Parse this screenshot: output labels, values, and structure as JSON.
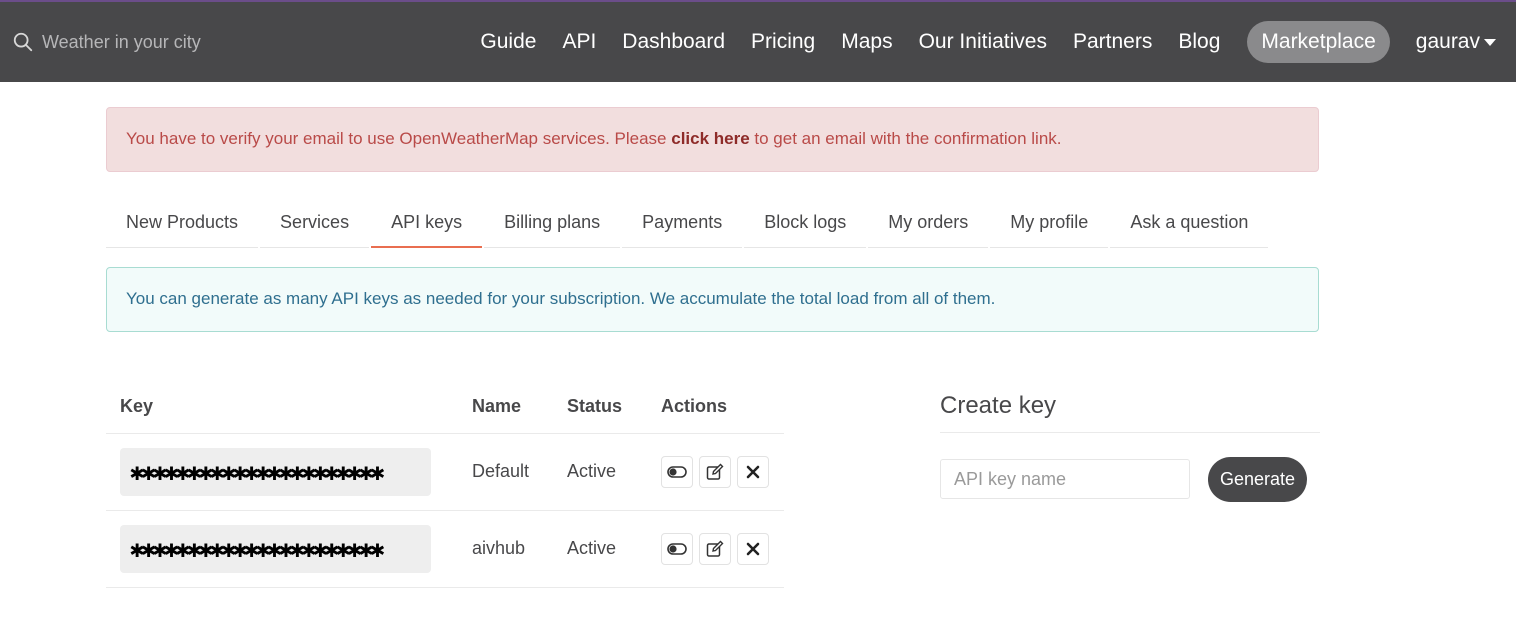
{
  "search": {
    "placeholder": "Weather in your city",
    "icon": "search-icon"
  },
  "nav": {
    "items": [
      "Guide",
      "API",
      "Dashboard",
      "Pricing",
      "Maps",
      "Our Initiatives",
      "Partners",
      "Blog"
    ],
    "marketplace": "Marketplace",
    "user": "gaurav"
  },
  "alert_verify": {
    "before": "You have to verify your email to use OpenWeatherMap services. Please ",
    "link": "click here",
    "after": " to get an email with the confirmation link."
  },
  "tabs": {
    "items": [
      "New Products",
      "Services",
      "API keys",
      "Billing plans",
      "Payments",
      "Block logs",
      "My orders",
      "My profile",
      "Ask a question"
    ],
    "active": "API keys"
  },
  "alert_info": "You can generate as many API keys as needed for your subscription. We accumulate the total load from all of them.",
  "table": {
    "headers": {
      "key": "Key",
      "name": "Name",
      "status": "Status",
      "actions": "Actions"
    },
    "rows": [
      {
        "key": "✱✱✱✱✱✱✱✱✱✱✱✱✱✱✱✱✱✱✱✱✱✱",
        "name": "Default",
        "status": "Active"
      },
      {
        "key": "✱✱✱✱✱✱✱✱✱✱✱✱✱✱✱✱✱✱✱✱✱✱",
        "name": "aivhub",
        "status": "Active"
      }
    ]
  },
  "create": {
    "title": "Create key",
    "input_placeholder": "API key name",
    "button": "Generate"
  },
  "colors": {
    "topbar": "#48484a",
    "accent_tab": "#e96e50",
    "danger_bg": "#f2dede",
    "info_bg": "#f2fbfa"
  }
}
